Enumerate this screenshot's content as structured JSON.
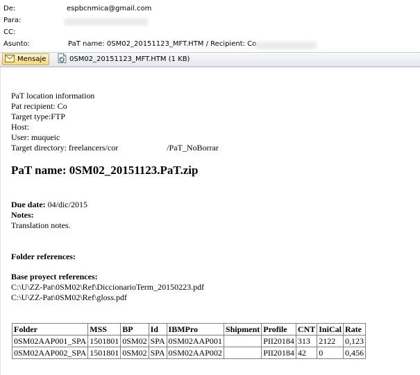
{
  "header": {
    "from_label": "De:",
    "from_value": "espbcnmica@gmail.com",
    "to_label": "Para:",
    "cc_label": "CC:",
    "subject_label": "Asunto:",
    "subject_value": "PaT name: 0SM02_20151123_MFT.HTM / Recipient: Co"
  },
  "attachments": {
    "message_tab": "Mensaje",
    "file_tab": "0SM02_20151123_MFT.HTM (1 KB)"
  },
  "message": {
    "location_heading": "PaT location information",
    "recipient": "Pat recipient: Co",
    "target_type": "Target type:FTP",
    "host": "Host:",
    "user": "User: muqueic",
    "target_dir_prefix": "Target directory: freelancers/cor",
    "target_dir_suffix": "/PaT_NoBorrar",
    "pat_name": "PaT name: 0SM02_20151123.PaT.zip",
    "due_label": "Due date:",
    "due_value": "04/dic/2015",
    "notes_label": "Notes:",
    "notes_value": "Translation notes.",
    "folder_refs": "Folder references:",
    "base_refs": "Base proyect references:",
    "ref1": "C:\\U\\ZZ-Pat\\0SM02\\Ref\\DiccionarioTerm_20150223.pdf",
    "ref2": "C:\\U\\ZZ-Pat\\0SM02\\Ref\\gloss.pdf"
  },
  "table": {
    "headers": [
      "Folder",
      "MSS",
      "BP",
      "Id",
      "IBMPro",
      "Shipment",
      "Profile",
      "CNT",
      "IniCal",
      "Rate"
    ],
    "rows": [
      [
        "0SM02AAP001_SPA",
        "1501801",
        "0SM02",
        "SPA",
        "0SM02AAP001",
        "",
        "PII20184",
        "313",
        "2122",
        "0,123"
      ],
      [
        "0SM02AAP002_SPA",
        "1501801",
        "0SM02",
        "SPA",
        "0SM02AAP002",
        "",
        "PII20184",
        "42",
        "0",
        "0,456"
      ]
    ]
  },
  "icons": {
    "message": "envelope-icon",
    "attachment": "internet-explorer-document-icon"
  }
}
